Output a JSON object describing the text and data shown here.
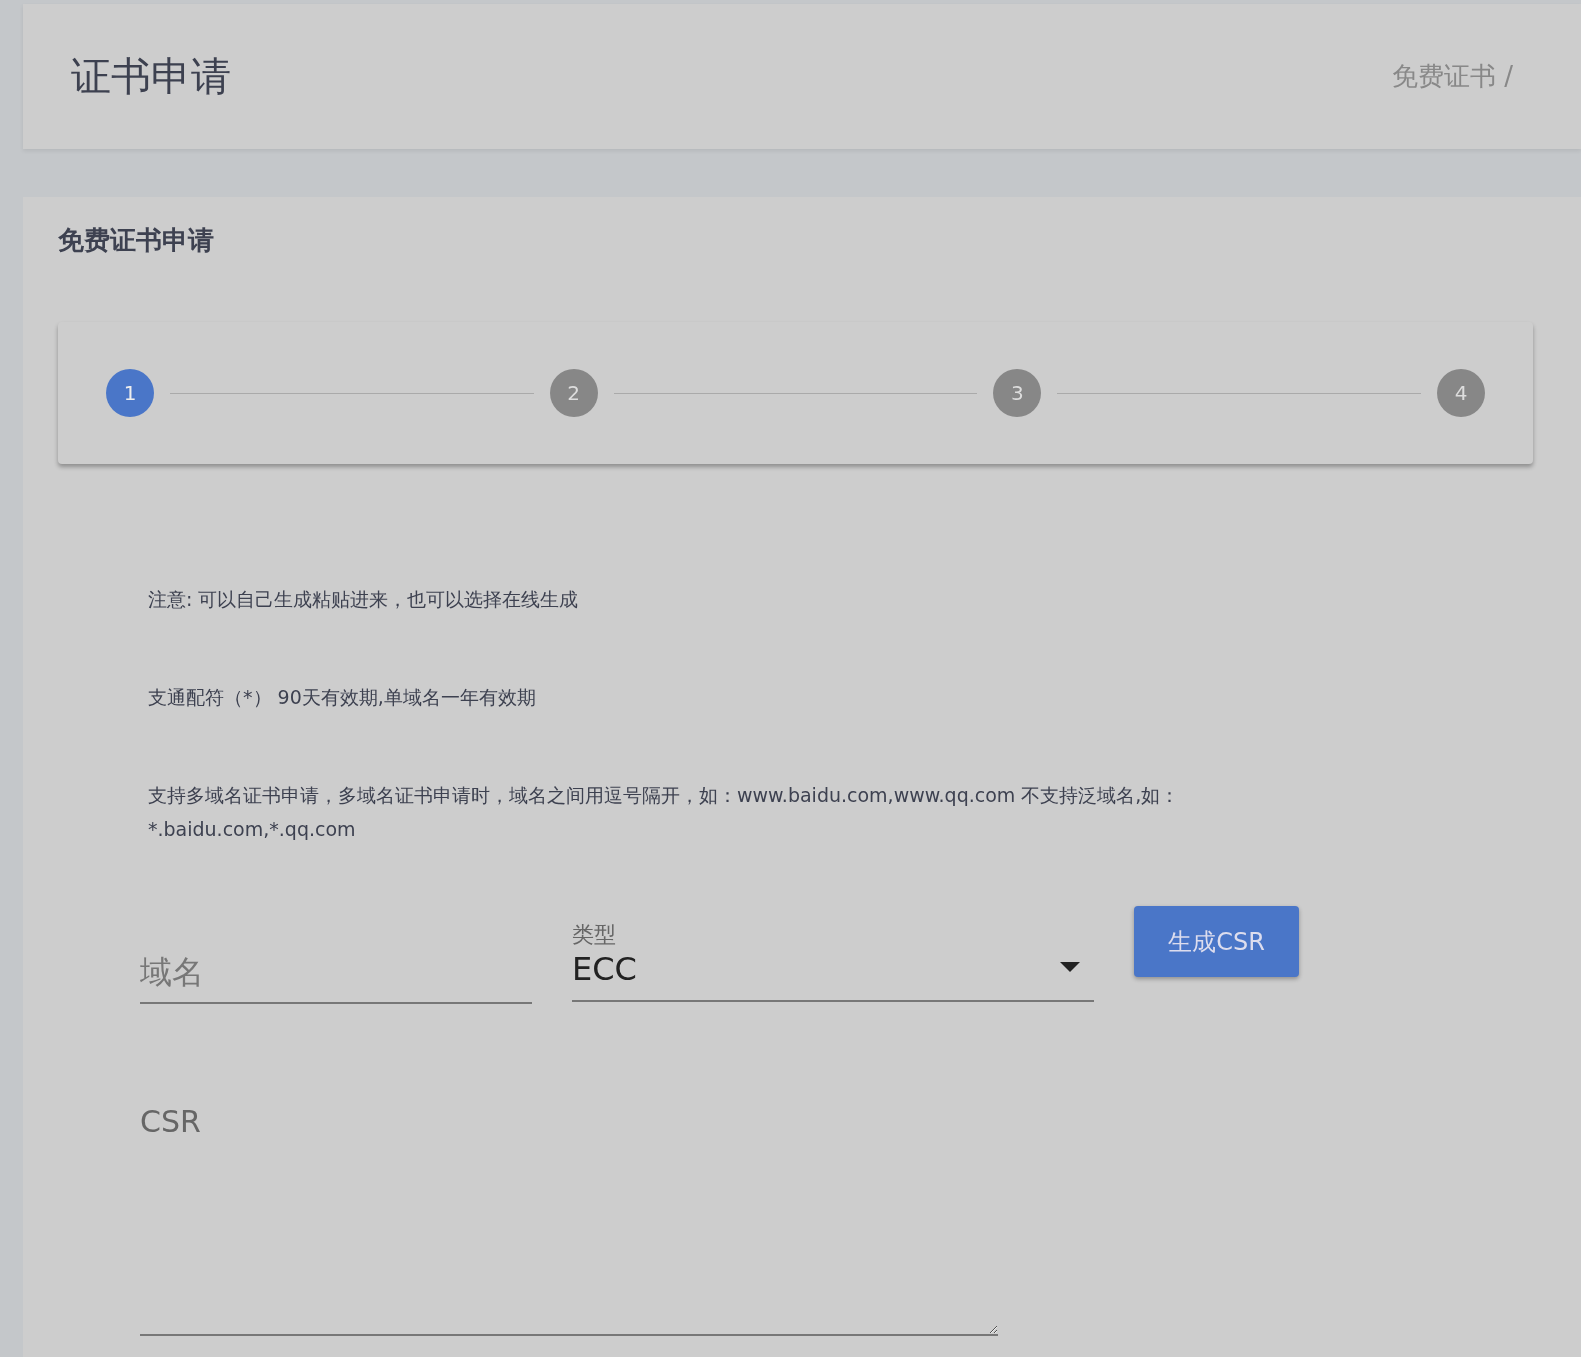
{
  "header": {
    "title": "证书申请",
    "breadcrumb": "免费证书 /"
  },
  "card": {
    "title": "免费证书申请"
  },
  "steps": [
    {
      "label": "1",
      "selected": true
    },
    {
      "label": "2",
      "selected": false
    },
    {
      "label": "3",
      "selected": false
    },
    {
      "label": "4",
      "selected": false
    }
  ],
  "notes": [
    "注意: 可以自己生成粘贴进来，也可以选择在线生成",
    "支通配符（*） 90天有效期,单域名一年有效期",
    "支持多域名证书申请，多域名证书申请时，域名之间用逗号隔开，如：www.baidu.com,www.qq.com 不支持泛域名,如：*.baidu.com,*.qq.com"
  ],
  "form": {
    "domain": {
      "placeholder": "域名"
    },
    "type": {
      "label": "类型",
      "value": "ECC"
    },
    "button": "生成CSR",
    "csr": {
      "placeholder": "CSR"
    }
  }
}
